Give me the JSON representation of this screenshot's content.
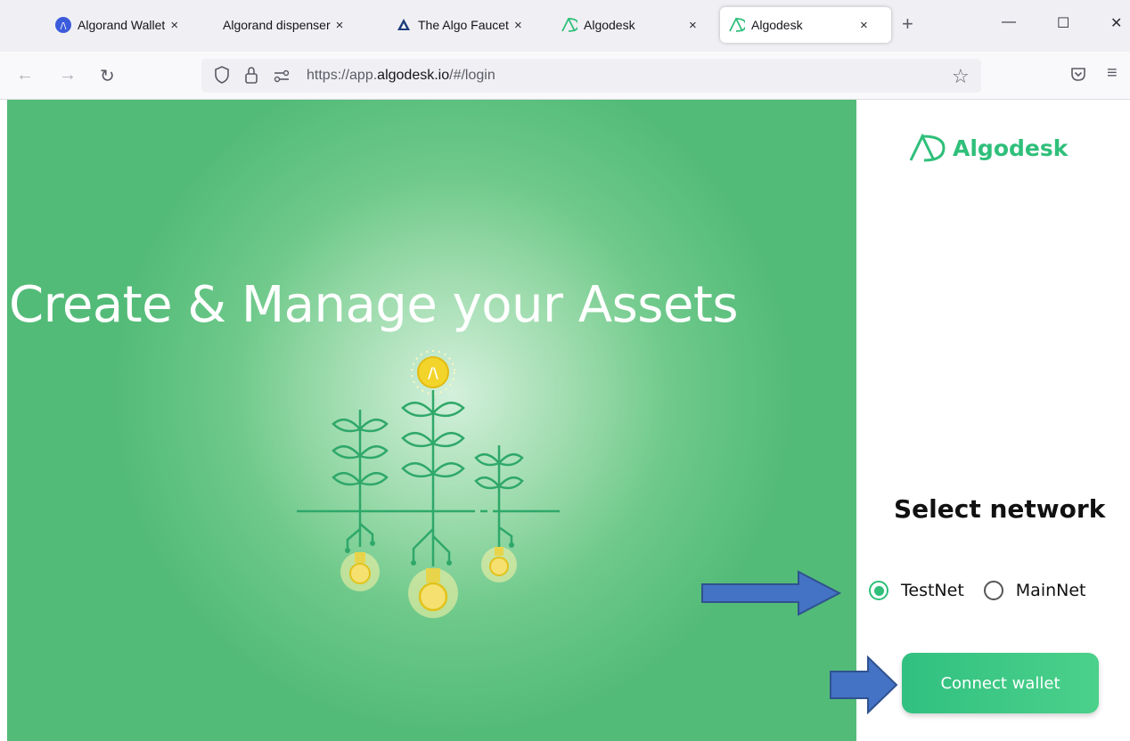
{
  "browser": {
    "tabs": [
      {
        "title": "Algorand Wallet",
        "icon": "algorand-wallet-icon"
      },
      {
        "title": "Algorand dispenser",
        "icon": ""
      },
      {
        "title": "The Algo Faucet",
        "icon": "algo-faucet-icon"
      },
      {
        "title": "Algodesk",
        "icon": "algodesk-icon"
      },
      {
        "title": "Algodesk",
        "icon": "algodesk-icon",
        "active": true
      }
    ],
    "url_prefix": "https://app.",
    "url_domain": "algodesk.io",
    "url_path": "/#/login"
  },
  "hero": {
    "title": "Create & Manage your Assets"
  },
  "sidebar": {
    "brand": "Algodesk",
    "network_title": "Select network",
    "networks": [
      {
        "label": "TestNet",
        "selected": true
      },
      {
        "label": "MainNet",
        "selected": false
      }
    ],
    "connect_label": "Connect wallet"
  },
  "colors": {
    "brand_green": "#2fbf7a",
    "hero_green": "#53bb78",
    "annotation_arrow": "#4472c4"
  }
}
